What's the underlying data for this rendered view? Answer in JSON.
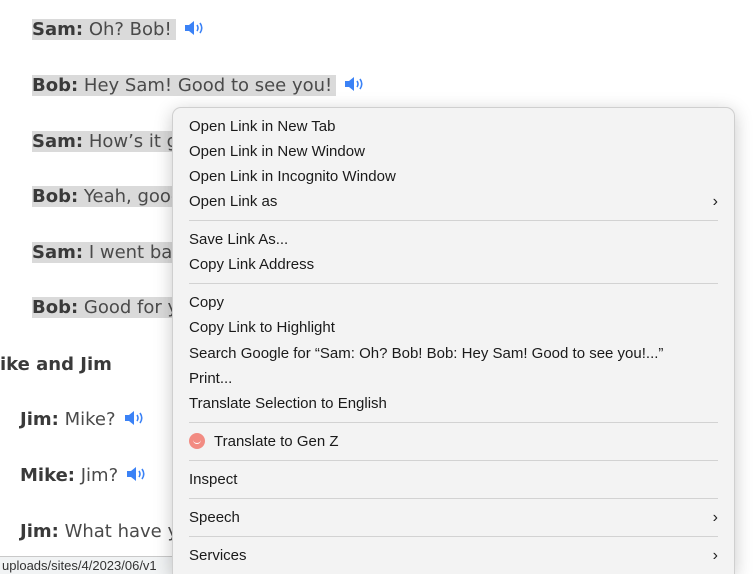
{
  "dialogue": {
    "lines": [
      {
        "speaker": "Sam:",
        "text": "Oh? Bob!"
      },
      {
        "speaker": "Bob:",
        "text": "Hey Sam! Good to see you!"
      },
      {
        "speaker": "Sam:",
        "text": "How’s it go"
      },
      {
        "speaker": "Bob:",
        "text": "Yeah, good."
      },
      {
        "speaker": "Sam:",
        "text": "I went back"
      },
      {
        "speaker": "Bob:",
        "text": "Good for yo"
      }
    ],
    "section_title": "ike and Jim",
    "lines2": [
      {
        "speaker": "Jim:",
        "text": "Mike?"
      },
      {
        "speaker": "Mike:",
        "text": "Jim?"
      },
      {
        "speaker": "Jim:",
        "text": "What have yo"
      }
    ],
    "speaker_icon": "speaker-icon",
    "accent": "#3b82f6"
  },
  "status_bar": {
    "url": "uploads/sites/4/2023/06/v1"
  },
  "context_menu": {
    "items": {
      "open_new_tab": "Open Link in New Tab",
      "open_new_window": "Open Link in New Window",
      "open_incognito": "Open Link in Incognito Window",
      "open_as": "Open Link as",
      "save_link": "Save Link As...",
      "copy_link": "Copy Link Address",
      "copy": "Copy",
      "copy_highlight": "Copy Link to Highlight",
      "search_google": "Search Google for “Sam: Oh? Bob!   Bob: Hey Sam! Good to see you!...”",
      "print": "Print...",
      "translate_selection": "Translate Selection to English",
      "translate_genz": "Translate to Gen Z",
      "inspect": "Inspect",
      "speech": "Speech",
      "services": "Services"
    },
    "submenu_chevron": "›",
    "genz_icon_color": "#f28b82"
  }
}
